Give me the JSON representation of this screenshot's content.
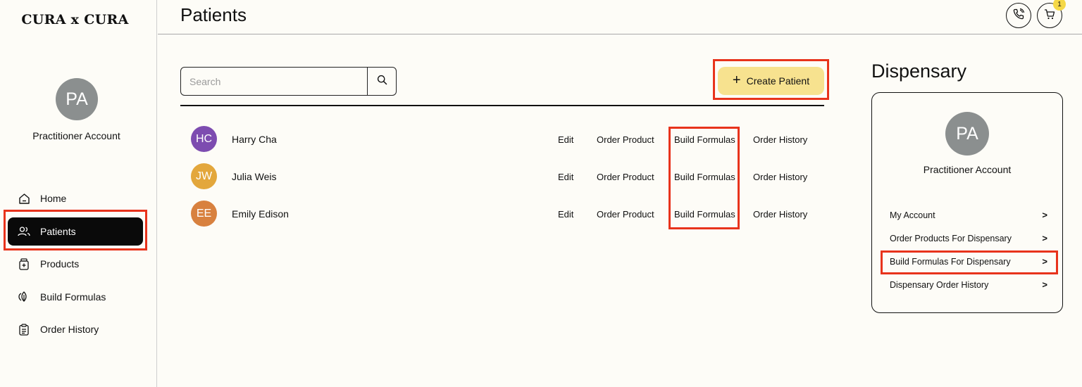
{
  "app": {
    "logo": "CURA x CURA"
  },
  "sidebar": {
    "avatar_initials": "PA",
    "account_name": "Practitioner Account",
    "items": [
      {
        "label": "Home",
        "icon": "home-icon"
      },
      {
        "label": "Patients",
        "icon": "users-icon",
        "active": true
      },
      {
        "label": "Products",
        "icon": "bottle-icon"
      },
      {
        "label": "Build Formulas",
        "icon": "leaf-icon"
      },
      {
        "label": "Order History",
        "icon": "clipboard-icon"
      }
    ]
  },
  "header": {
    "title": "Patients",
    "cart_count": "1",
    "icons": [
      "phone-icon",
      "cart-icon"
    ]
  },
  "main": {
    "search": {
      "placeholder": "Search",
      "value": ""
    },
    "create_label": "Create Patient",
    "patients": [
      {
        "initials": "HC",
        "name": "Harry Cha",
        "color": "#7d4cb0"
      },
      {
        "initials": "JW",
        "name": "Julia Weis",
        "color": "#e3a73c"
      },
      {
        "initials": "EE",
        "name": "Emily Edison",
        "color": "#d8813f"
      }
    ],
    "actions": {
      "edit": "Edit",
      "order_product": "Order Product",
      "build_formulas": "Build Formulas",
      "order_history": "Order History"
    }
  },
  "dispensary": {
    "title": "Dispensary",
    "avatar_initials": "PA",
    "account_name": "Practitioner Account",
    "items": [
      {
        "label": "My Account"
      },
      {
        "label": "Order Products For Dispensary"
      },
      {
        "label": "Build Formulas For Dispensary"
      },
      {
        "label": "Dispensary Order History"
      }
    ]
  },
  "colors": {
    "accent_yellow": "#f7e28f",
    "highlight_red": "#e8331c",
    "background": "#fdfcf7",
    "avatar_gray": "#8b8f8f"
  }
}
